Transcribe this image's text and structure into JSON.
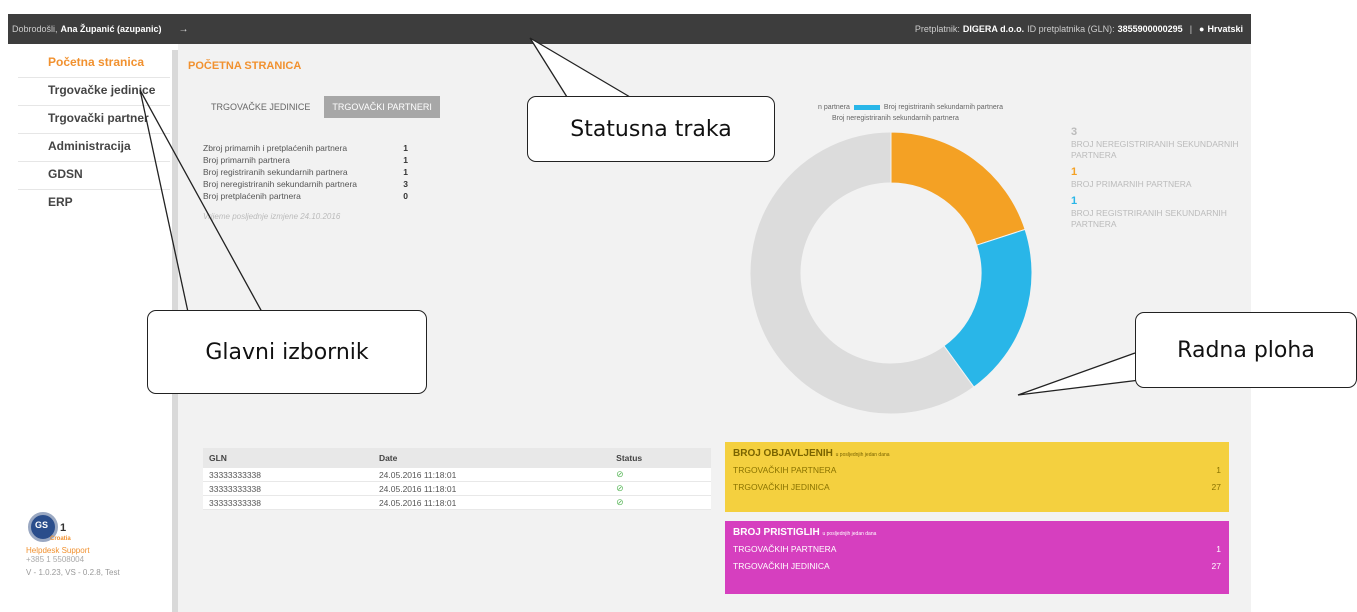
{
  "topbar": {
    "welcome": "Dobrodošli,",
    "user": "Ana Županić (azupanic)",
    "logout_icon": "→",
    "subscriber_label": "Pretplatnik:",
    "subscriber": "DIGERA d.o.o.",
    "gln_label": "ID pretplatnika (GLN):",
    "gln": "3855900000295",
    "separator": "|",
    "language_icon": "●",
    "language": "Hrvatski"
  },
  "sidebar": {
    "items": [
      {
        "label": "Početna stranica"
      },
      {
        "label": "Trgovačke jedinice"
      },
      {
        "label": "Trgovački partner"
      },
      {
        "label": "Administracija"
      },
      {
        "label": "GDSN"
      },
      {
        "label": "ERP"
      }
    ],
    "logo_gs": "GS",
    "logo_one": "1",
    "logo_region": "Croatia",
    "helpdesk": "Helpdesk Support",
    "phone": "+385 1 5508004",
    "version": "V - 1.0.23, VS - 0.2.8, Test"
  },
  "main": {
    "title": "POČETNA STRANICA",
    "tabs": [
      {
        "label": "TRGOVAČKE JEDINICE"
      },
      {
        "label": "TRGOVAČKI PARTNERI"
      }
    ],
    "stats": [
      {
        "label": "Zbroj primarnih i pretplaćenih partnera",
        "value": "1"
      },
      {
        "label": "Broj primarnih partnera",
        "value": "1"
      },
      {
        "label": "Broj registriranih sekundarnih partnera",
        "value": "1"
      },
      {
        "label": "Broj neregistriranih sekundarnih partnera",
        "value": "3"
      },
      {
        "label": "Broj pretplaćenih partnera",
        "value": "0"
      }
    ],
    "last_change": "Vrijeme posljednje izmjene 24.10.2016",
    "legend": [
      {
        "label": "n partnera",
        "color": "#f4a124"
      },
      {
        "label": "Broj registriranih sekundarnih partnera",
        "color": "#29b6e8"
      },
      {
        "label": "Broj neregistriranih sekundarnih partnera",
        "color": "#dcdcdc"
      }
    ],
    "chart_side": [
      {
        "value": "3",
        "label": "BROJ NEREGISTRIRANIH SEKUNDARNIH PARTNERA",
        "color": "#bbbbbb"
      },
      {
        "value": "1",
        "label": "BROJ PRIMARNIH PARTNERA",
        "color": "#f4a124"
      },
      {
        "value": "1",
        "label": "BROJ REGISTRIRANIH SEKUNDARNIH PARTNERA",
        "color": "#29b6e8"
      }
    ],
    "table": {
      "headers": [
        "GLN",
        "Date",
        "Status"
      ],
      "rows": [
        {
          "gln": "33333333338",
          "date": "24.05.2016 11:18:01",
          "status_icon": "⊘"
        },
        {
          "gln": "33333333338",
          "date": "24.05.2016 11:18:01",
          "status_icon": "⊘"
        },
        {
          "gln": "33333333338",
          "date": "24.05.2016 11:18:01",
          "status_icon": "⊘"
        }
      ]
    },
    "published": {
      "title": "BROJ OBJAVLJENIH",
      "subtitle": "u posljednjih jedan dana",
      "rows": [
        {
          "label": "TRGOVAČKIH PARTNERA",
          "value": "1"
        },
        {
          "label": "TRGOVAČKIH JEDINICA",
          "value": "27"
        }
      ]
    },
    "received": {
      "title": "BROJ PRISTIGLIH",
      "subtitle": "u posljednjih jedan dana",
      "rows": [
        {
          "label": "TRGOVAČKIH PARTNERA",
          "value": "1"
        },
        {
          "label": "TRGOVAČKIH JEDINICA",
          "value": "27"
        }
      ]
    }
  },
  "callouts": {
    "status_bar": "Statusna traka",
    "main_menu": "Glavni izbornik",
    "work_area": "Radna ploha"
  },
  "chart_data": {
    "type": "pie",
    "categories": [
      "Broj primarnih partnera",
      "Broj registriranih sekundarnih partnera",
      "Broj neregistriranih sekundarnih partnera"
    ],
    "values": [
      1,
      1,
      3
    ],
    "colors": [
      "#f4a124",
      "#29b6e8",
      "#dcdcdc"
    ]
  }
}
